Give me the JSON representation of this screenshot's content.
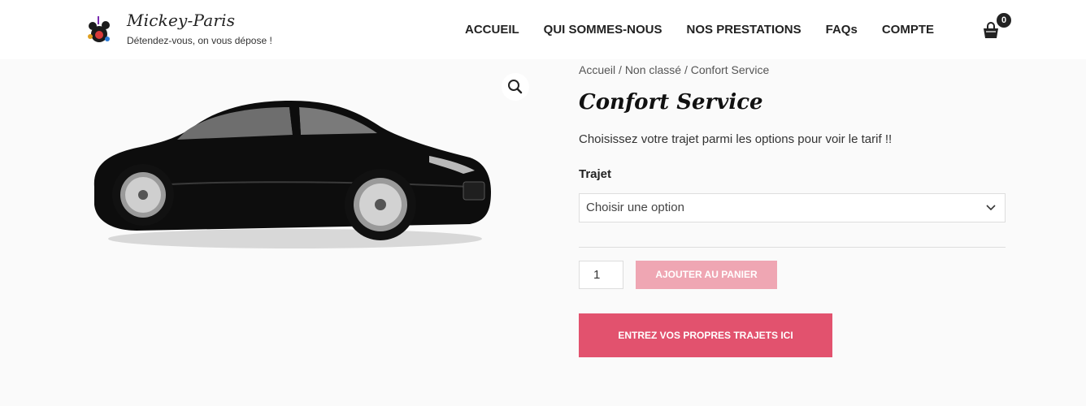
{
  "header": {
    "site_title": "Mickey-Paris",
    "tagline": "Détendez-vous, on vous dépose !",
    "nav": [
      "ACCUEIL",
      "QUI SOMMES-NOUS",
      "NOS PRESTATIONS",
      "FAQs",
      "COMPTE"
    ],
    "cart_count": "0"
  },
  "breadcrumb": {
    "home": "Accueil",
    "sep1": " / ",
    "category": "Non classé",
    "sep2": " / ",
    "current": "Confort Service"
  },
  "product": {
    "title": "Confort Service",
    "description": "Choisissez votre trajet parmi les options pour voir le tarif !!",
    "variation_label": "Trajet",
    "select_value": "Choisir une option",
    "quantity": "1",
    "add_to_cart_label": "AJOUTER AU PANIER",
    "own_trips_label": "ENTREZ VOS PROPRES TRAJETS ICI"
  },
  "colors": {
    "accent": "#e2526e",
    "accent_disabled": "#efa6b3"
  },
  "icons": {
    "zoom": "magnifier-icon",
    "cart": "shopping-bag-icon",
    "select": "chevron-down-icon"
  }
}
